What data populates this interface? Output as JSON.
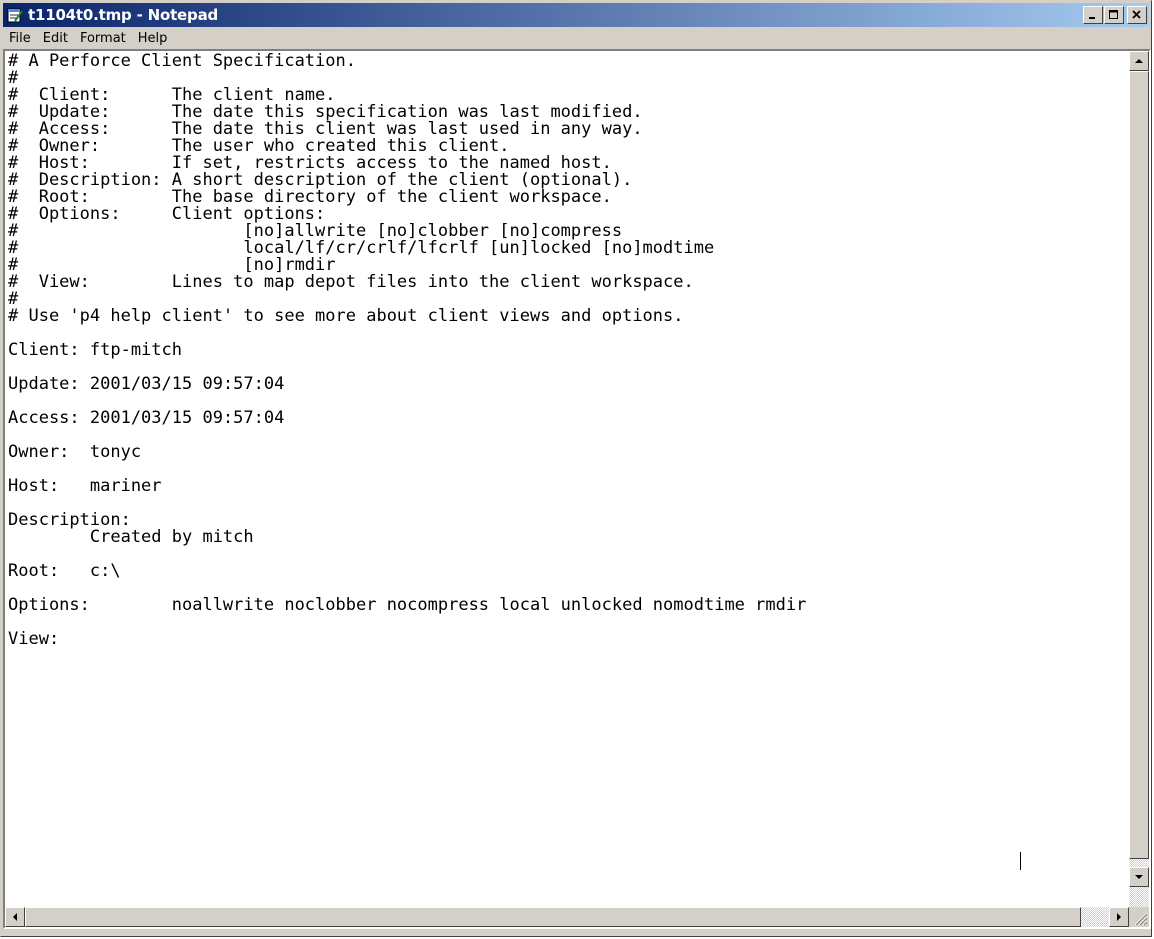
{
  "window": {
    "title": "t1104t0.tmp - Notepad"
  },
  "menu": {
    "file": "File",
    "edit": "Edit",
    "format": "Format",
    "help": "Help"
  },
  "editor": {
    "lines": [
      "# A Perforce Client Specification.",
      "#",
      "#  Client:      The client name.",
      "#  Update:      The date this specification was last modified.",
      "#  Access:      The date this client was last used in any way.",
      "#  Owner:       The user who created this client.",
      "#  Host:        If set, restricts access to the named host.",
      "#  Description: A short description of the client (optional).",
      "#  Root:        The base directory of the client workspace.",
      "#  Options:     Client options:",
      "#                      [no]allwrite [no]clobber [no]compress",
      "#                      local/lf/cr/crlf/lfcrlf [un]locked [no]modtime",
      "#                      [no]rmdir",
      "#  View:        Lines to map depot files into the client workspace.",
      "#",
      "# Use 'p4 help client' to see more about client views and options.",
      "",
      "Client: ftp-mitch",
      "",
      "Update: 2001/03/15 09:57:04",
      "",
      "Access: 2001/03/15 09:57:04",
      "",
      "Owner:  tonyc",
      "",
      "Host:   mariner",
      "",
      "Description:",
      "        Created by mitch",
      "",
      "Root:   c:\\",
      "",
      "Options:        noallwrite noclobber nocompress local unlocked nomodtime rmdir",
      "",
      "View:"
    ]
  }
}
